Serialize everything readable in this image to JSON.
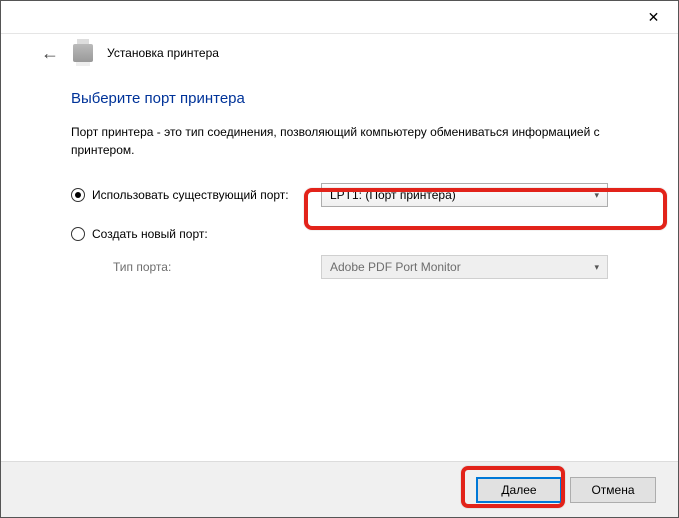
{
  "titlebar": {
    "close_glyph": "✕"
  },
  "header": {
    "back_glyph": "←",
    "wizard_title": "Установка принтера"
  },
  "content": {
    "heading": "Выберите порт принтера",
    "description": "Порт принтера - это тип соединения, позволяющий компьютеру обмениваться информацией с принтером.",
    "option_existing": {
      "label": "Использовать существующий порт:",
      "checked": true,
      "value": "LPT1: (Порт принтера)"
    },
    "option_new": {
      "label": "Создать новый порт:",
      "checked": false,
      "type_label": "Тип порта:",
      "value": "Adobe PDF Port Monitor"
    }
  },
  "footer": {
    "next": "Далее",
    "cancel": "Отмена"
  }
}
